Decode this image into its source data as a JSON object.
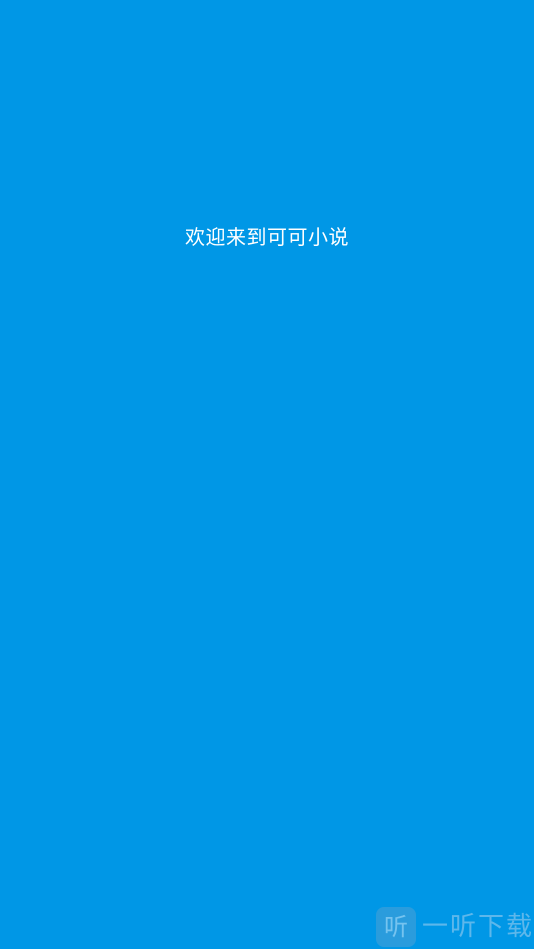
{
  "splash": {
    "welcome_text": "欢迎来到可可小说",
    "background_color": "#0097E6",
    "text_color": "#FFFFFF"
  },
  "watermark": {
    "logo_glyph": "听",
    "text": "一听下载"
  }
}
